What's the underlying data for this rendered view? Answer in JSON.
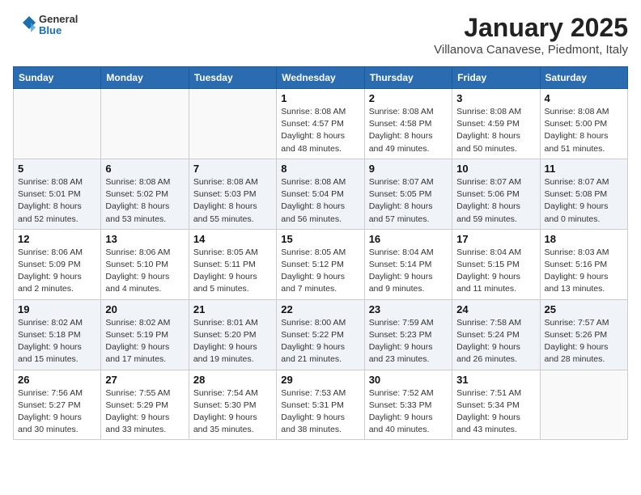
{
  "logo": {
    "line1": "General",
    "line2": "Blue"
  },
  "title": "January 2025",
  "subtitle": "Villanova Canavese, Piedmont, Italy",
  "days_of_week": [
    "Sunday",
    "Monday",
    "Tuesday",
    "Wednesday",
    "Thursday",
    "Friday",
    "Saturday"
  ],
  "weeks": [
    [
      {
        "day": "",
        "info": ""
      },
      {
        "day": "",
        "info": ""
      },
      {
        "day": "",
        "info": ""
      },
      {
        "day": "1",
        "info": "Sunrise: 8:08 AM\nSunset: 4:57 PM\nDaylight: 8 hours\nand 48 minutes."
      },
      {
        "day": "2",
        "info": "Sunrise: 8:08 AM\nSunset: 4:58 PM\nDaylight: 8 hours\nand 49 minutes."
      },
      {
        "day": "3",
        "info": "Sunrise: 8:08 AM\nSunset: 4:59 PM\nDaylight: 8 hours\nand 50 minutes."
      },
      {
        "day": "4",
        "info": "Sunrise: 8:08 AM\nSunset: 5:00 PM\nDaylight: 8 hours\nand 51 minutes."
      }
    ],
    [
      {
        "day": "5",
        "info": "Sunrise: 8:08 AM\nSunset: 5:01 PM\nDaylight: 8 hours\nand 52 minutes."
      },
      {
        "day": "6",
        "info": "Sunrise: 8:08 AM\nSunset: 5:02 PM\nDaylight: 8 hours\nand 53 minutes."
      },
      {
        "day": "7",
        "info": "Sunrise: 8:08 AM\nSunset: 5:03 PM\nDaylight: 8 hours\nand 55 minutes."
      },
      {
        "day": "8",
        "info": "Sunrise: 8:08 AM\nSunset: 5:04 PM\nDaylight: 8 hours\nand 56 minutes."
      },
      {
        "day": "9",
        "info": "Sunrise: 8:07 AM\nSunset: 5:05 PM\nDaylight: 8 hours\nand 57 minutes."
      },
      {
        "day": "10",
        "info": "Sunrise: 8:07 AM\nSunset: 5:06 PM\nDaylight: 8 hours\nand 59 minutes."
      },
      {
        "day": "11",
        "info": "Sunrise: 8:07 AM\nSunset: 5:08 PM\nDaylight: 9 hours\nand 0 minutes."
      }
    ],
    [
      {
        "day": "12",
        "info": "Sunrise: 8:06 AM\nSunset: 5:09 PM\nDaylight: 9 hours\nand 2 minutes."
      },
      {
        "day": "13",
        "info": "Sunrise: 8:06 AM\nSunset: 5:10 PM\nDaylight: 9 hours\nand 4 minutes."
      },
      {
        "day": "14",
        "info": "Sunrise: 8:05 AM\nSunset: 5:11 PM\nDaylight: 9 hours\nand 5 minutes."
      },
      {
        "day": "15",
        "info": "Sunrise: 8:05 AM\nSunset: 5:12 PM\nDaylight: 9 hours\nand 7 minutes."
      },
      {
        "day": "16",
        "info": "Sunrise: 8:04 AM\nSunset: 5:14 PM\nDaylight: 9 hours\nand 9 minutes."
      },
      {
        "day": "17",
        "info": "Sunrise: 8:04 AM\nSunset: 5:15 PM\nDaylight: 9 hours\nand 11 minutes."
      },
      {
        "day": "18",
        "info": "Sunrise: 8:03 AM\nSunset: 5:16 PM\nDaylight: 9 hours\nand 13 minutes."
      }
    ],
    [
      {
        "day": "19",
        "info": "Sunrise: 8:02 AM\nSunset: 5:18 PM\nDaylight: 9 hours\nand 15 minutes."
      },
      {
        "day": "20",
        "info": "Sunrise: 8:02 AM\nSunset: 5:19 PM\nDaylight: 9 hours\nand 17 minutes."
      },
      {
        "day": "21",
        "info": "Sunrise: 8:01 AM\nSunset: 5:20 PM\nDaylight: 9 hours\nand 19 minutes."
      },
      {
        "day": "22",
        "info": "Sunrise: 8:00 AM\nSunset: 5:22 PM\nDaylight: 9 hours\nand 21 minutes."
      },
      {
        "day": "23",
        "info": "Sunrise: 7:59 AM\nSunset: 5:23 PM\nDaylight: 9 hours\nand 23 minutes."
      },
      {
        "day": "24",
        "info": "Sunrise: 7:58 AM\nSunset: 5:24 PM\nDaylight: 9 hours\nand 26 minutes."
      },
      {
        "day": "25",
        "info": "Sunrise: 7:57 AM\nSunset: 5:26 PM\nDaylight: 9 hours\nand 28 minutes."
      }
    ],
    [
      {
        "day": "26",
        "info": "Sunrise: 7:56 AM\nSunset: 5:27 PM\nDaylight: 9 hours\nand 30 minutes."
      },
      {
        "day": "27",
        "info": "Sunrise: 7:55 AM\nSunset: 5:29 PM\nDaylight: 9 hours\nand 33 minutes."
      },
      {
        "day": "28",
        "info": "Sunrise: 7:54 AM\nSunset: 5:30 PM\nDaylight: 9 hours\nand 35 minutes."
      },
      {
        "day": "29",
        "info": "Sunrise: 7:53 AM\nSunset: 5:31 PM\nDaylight: 9 hours\nand 38 minutes."
      },
      {
        "day": "30",
        "info": "Sunrise: 7:52 AM\nSunset: 5:33 PM\nDaylight: 9 hours\nand 40 minutes."
      },
      {
        "day": "31",
        "info": "Sunrise: 7:51 AM\nSunset: 5:34 PM\nDaylight: 9 hours\nand 43 minutes."
      },
      {
        "day": "",
        "info": ""
      }
    ]
  ]
}
